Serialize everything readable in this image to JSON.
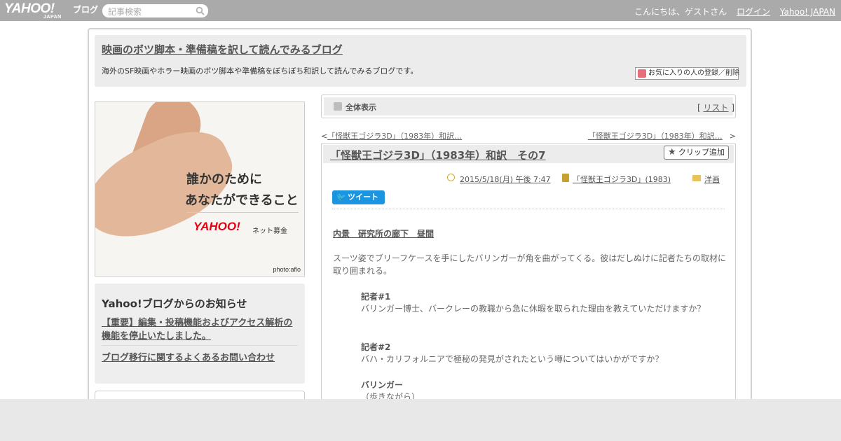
{
  "topbar": {
    "logo_main": "YAHOO!",
    "logo_sub": "JAPAN",
    "logo_blog": "ブログ",
    "search_placeholder": "記事検索",
    "greeting": "こんにちは、ゲストさん",
    "login": "ログイン",
    "yahoo_japan": "Yahoo! JAPAN"
  },
  "header": {
    "blog_title": "映画のボツ脚本・準備稿を訳して読んでみるブログ",
    "description": "海外のSF映画やホラー映画のボツ脚本や準備稿をぼちぼち和訳して読んでみるブログです。",
    "favorite_button": "お気に入りの人の登録／削除"
  },
  "ad": {
    "line1": "誰かのために",
    "line2": "あなたができること",
    "logo": "YAHOO!",
    "logo_sub": "ネット募金",
    "credit": "photo:aflo"
  },
  "notice": {
    "title": "Yahoo!ブログからのお知らせ",
    "link1": "【重要】編集・投稿機能およびアクセス解析の機能を停止いたしました。",
    "link2": "ブログ移行に関するよくあるお問い合わせ"
  },
  "view_bar": {
    "label": "全体表示",
    "list_open": "[ ",
    "list": "リスト",
    "list_close": " ]"
  },
  "nav": {
    "prev_arrow": "<",
    "prev": "「怪獣王ゴジラ3D」（1983年）和訳…",
    "next": "「怪獣王ゴジラ3D」（1983年）和訳…",
    "next_arrow": ">"
  },
  "article": {
    "title": "「怪獣王ゴジラ3D」（1983年）和訳　その7",
    "clip_button": "クリップ追加",
    "date": "2015/5/18(月) 午後 7:47",
    "category": "「怪獣王ゴジラ3D」(1983)",
    "genre": "洋画",
    "tweet": "ツイート",
    "scene": "内景　研究所の廊下　昼間",
    "paragraph": "スーツ姿でブリーフケースを手にしたバリンガーが角を曲がってくる。彼はだしぬけに記者たちの取材に取り囲まれる。",
    "dialogue": [
      {
        "speaker": "記者#1",
        "text": "バリンガー博士、バークレーの教職から急に休暇を取られた理由を教えていただけますか？"
      },
      {
        "speaker": "記者#2",
        "text": "バハ・カリフォルニアで極秘の発見がされたという噂についてはいかがですか？"
      },
      {
        "speaker": "バリンガー",
        "text": "（歩きながら）"
      }
    ]
  }
}
